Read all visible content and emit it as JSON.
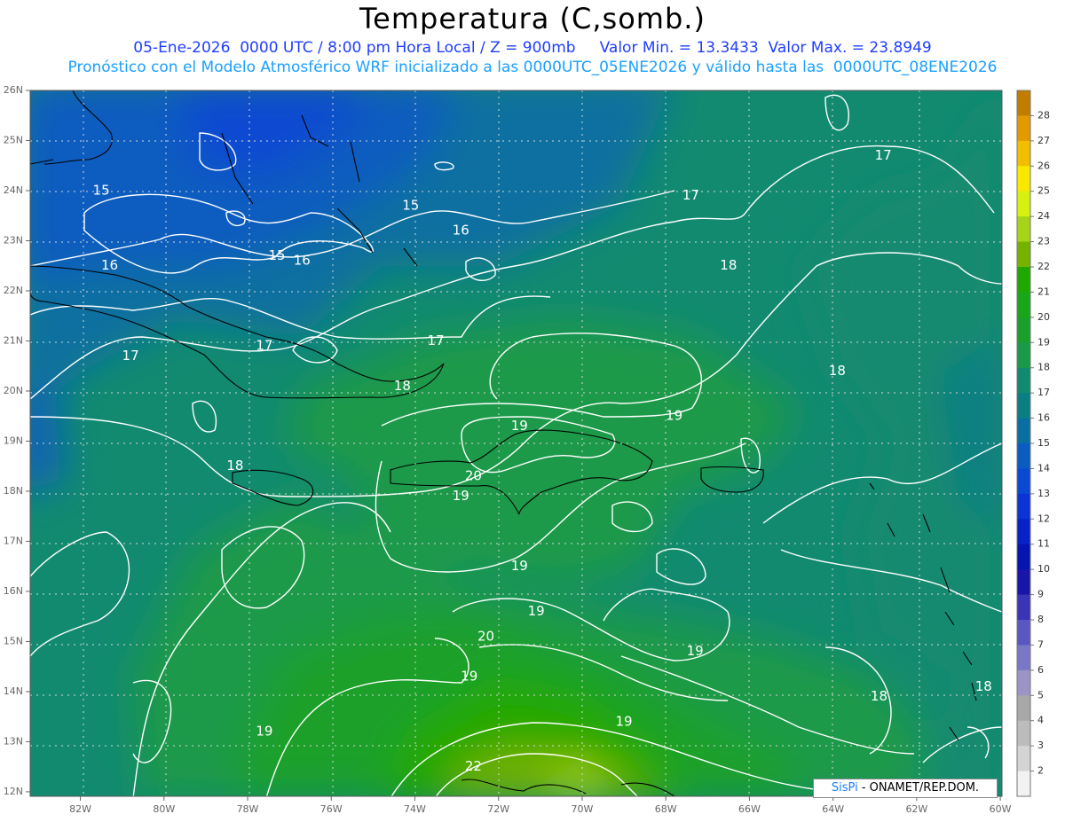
{
  "header": {
    "title": "Temperatura (C,somb.)",
    "subtitle_line1": "05-Ene-2026  0000 UTC / 8:00 pm Hora Local / Z = 900mb     Valor Min. = 13.3433  Valor Max. = 23.8949",
    "subtitle_line2": "Pronóstico con el Modelo Atmosférico WRF inicializado a las 0000UTC_05ENE2026 y válido hasta las  0000UTC_08ENE2026"
  },
  "axes": {
    "lat_labels": [
      "26N",
      "25N",
      "24N",
      "23N",
      "22N",
      "21N",
      "20N",
      "19N",
      "18N",
      "17N",
      "16N",
      "15N",
      "14N",
      "13N",
      "12N"
    ],
    "lon_labels": [
      "82W",
      "80W",
      "78W",
      "76W",
      "74W",
      "72W",
      "70W",
      "68W",
      "66W",
      "64W",
      "62W",
      "60W"
    ]
  },
  "colorbar": {
    "labels": [
      "28",
      "27",
      "26",
      "25",
      "24",
      "23",
      "22",
      "21",
      "20",
      "19",
      "18",
      "17",
      "16",
      "15",
      "14",
      "13",
      "12",
      "11",
      "10",
      "9",
      "8",
      "7",
      "6",
      "5",
      "4",
      "3",
      "2"
    ],
    "colors": [
      "#c07d00",
      "#e39a00",
      "#f2be00",
      "#f9e900",
      "#d6f010",
      "#a6d418",
      "#76b200",
      "#20a800",
      "#1aa61a",
      "#1aa02a",
      "#1a9a48",
      "#128a70",
      "#0b7e84",
      "#0a6fa0",
      "#0a5cc0",
      "#0a4ad2",
      "#0a34d4",
      "#0822c8",
      "#0614b0",
      "#1816a8",
      "#3a34b6",
      "#5a58c0",
      "#7a78c6",
      "#9c94c6",
      "#a8a8a8",
      "#bcbcbc",
      "#d4d4d4",
      "#f2f2f2"
    ]
  },
  "contour_labels": [
    {
      "text": "15",
      "lon": -81.5,
      "lat": 24.0
    },
    {
      "text": "15",
      "lon": -74.1,
      "lat": 23.7
    },
    {
      "text": "15",
      "lon": -77.3,
      "lat": 22.7
    },
    {
      "text": "16",
      "lon": -81.3,
      "lat": 22.5
    },
    {
      "text": "16",
      "lon": -76.7,
      "lat": 22.6
    },
    {
      "text": "16",
      "lon": -72.9,
      "lat": 23.2
    },
    {
      "text": "17",
      "lon": -80.8,
      "lat": 20.7
    },
    {
      "text": "17",
      "lon": -77.6,
      "lat": 20.9
    },
    {
      "text": "17",
      "lon": -73.5,
      "lat": 21.0
    },
    {
      "text": "17",
      "lon": -67.4,
      "lat": 23.9
    },
    {
      "text": "17",
      "lon": -62.8,
      "lat": 24.7
    },
    {
      "text": "18",
      "lon": -74.3,
      "lat": 20.1
    },
    {
      "text": "18",
      "lon": -78.3,
      "lat": 18.5
    },
    {
      "text": "18",
      "lon": -66.5,
      "lat": 22.5
    },
    {
      "text": "18",
      "lon": -63.9,
      "lat": 20.4
    },
    {
      "text": "18",
      "lon": -62.9,
      "lat": 13.9
    },
    {
      "text": "18",
      "lon": -60.4,
      "lat": 14.1
    },
    {
      "text": "19",
      "lon": -71.5,
      "lat": 19.3
    },
    {
      "text": "19",
      "lon": -72.9,
      "lat": 17.9
    },
    {
      "text": "19",
      "lon": -71.5,
      "lat": 16.5
    },
    {
      "text": "19",
      "lon": -71.1,
      "lat": 15.6
    },
    {
      "text": "19",
      "lon": -67.8,
      "lat": 19.5
    },
    {
      "text": "19",
      "lon": -67.3,
      "lat": 14.8
    },
    {
      "text": "19",
      "lon": -72.7,
      "lat": 14.3
    },
    {
      "text": "19",
      "lon": -69.0,
      "lat": 13.4
    },
    {
      "text": "19",
      "lon": -77.6,
      "lat": 13.2
    },
    {
      "text": "20",
      "lon": -72.6,
      "lat": 18.3
    },
    {
      "text": "20",
      "lon": -72.3,
      "lat": 15.1
    },
    {
      "text": "22",
      "lon": -72.6,
      "lat": 12.5
    }
  ],
  "credit": {
    "brand": "SisPi",
    "org": "- ONAMET/REP.DOM."
  }
}
